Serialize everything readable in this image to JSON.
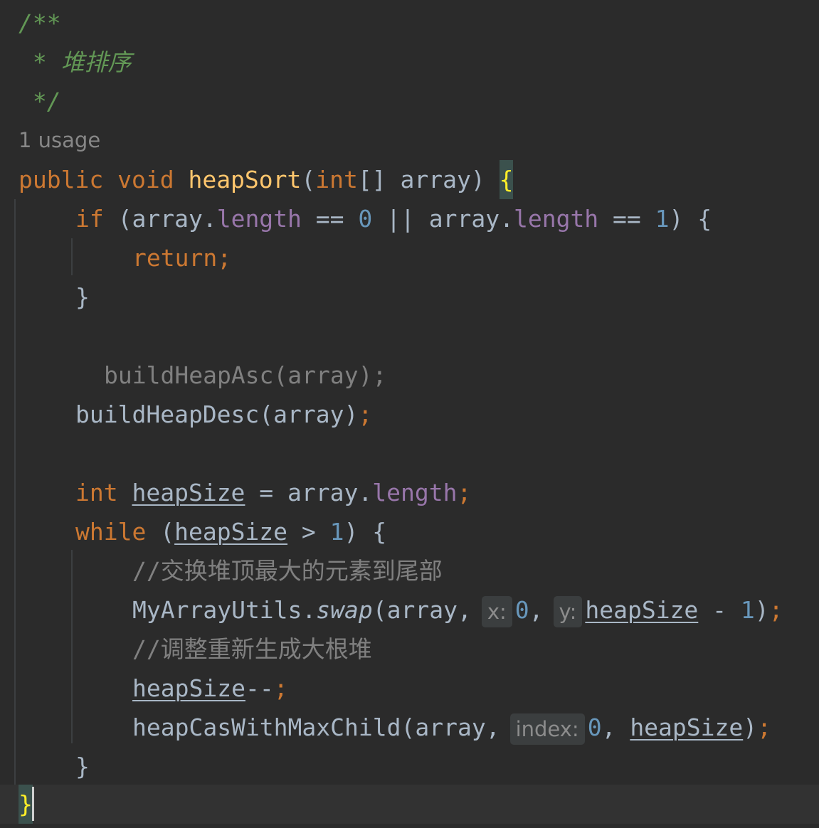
{
  "editor": {
    "doc_comment_open": "/**",
    "doc_comment_text": " * 堆排序",
    "doc_comment_close": " */",
    "usage_hint": "1 usage",
    "sig": {
      "kw_public": "public",
      "kw_void": "void",
      "method_name": "heapSort",
      "paren_open": "(",
      "kw_int": "int",
      "param": "[] array) ",
      "open_brace": "{"
    },
    "if_line": {
      "kw_if": "if",
      "p1": " (array.",
      "length1": "length",
      "op1": " == ",
      "zero": "0",
      "p2": " || array.",
      "length2": "length",
      "op2": " == ",
      "one": "1",
      "p3": ") {"
    },
    "return_kw": "return",
    "return_semi": ";",
    "close_if": "}",
    "commented_call": "buildHeapAsc(array);",
    "desc_call": "buildHeapDesc(array)",
    "desc_semi": ";",
    "decl": {
      "kw_int": "int",
      "var": "heapSize",
      "assign": " = array.",
      "length": "length",
      "semi": ";"
    },
    "while_line": {
      "kw_while": "while",
      "p1": " (",
      "var": "heapSize",
      "op": " > ",
      "one": "1",
      "p2": ") {"
    },
    "comment_swap": "//交换堆顶最大的元素到尾部",
    "swap_line": {
      "prefix": "MyArrayUtils.",
      "method": "swap",
      "args1": "(array,",
      "hint_x": "x:",
      "zero": "0",
      "comma": ",",
      "hint_y": "y:",
      "var": "heapSize",
      "minus": " - ",
      "one": "1",
      "close": ")",
      "semi": ";"
    },
    "comment_adjust": "//调整重新生成大根堆",
    "dec_line": {
      "var": "heapSize",
      "op": "--",
      "semi": ";"
    },
    "cas_line": {
      "prefix": "heapCasWithMaxChild(array,",
      "hint_index": "index:",
      "zero": "0",
      "comma": ",",
      "var": "heapSize",
      "close": ")",
      "semi": ";"
    },
    "close_while": "}",
    "close_method": "}"
  }
}
